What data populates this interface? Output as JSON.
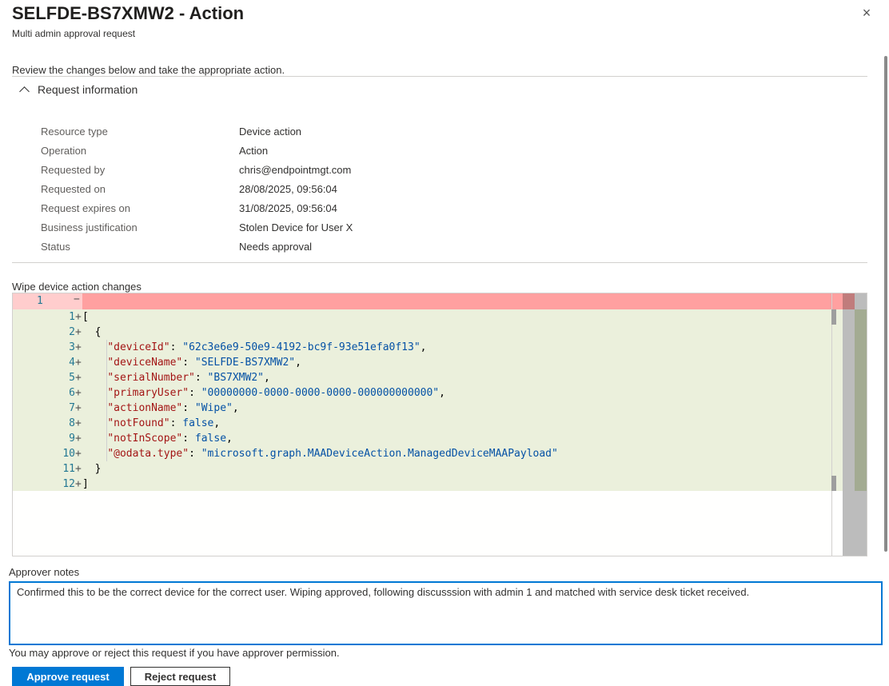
{
  "header": {
    "title": "SELFDE-BS7XMW2 - Action",
    "subtitle": "Multi admin approval request",
    "close_icon": "×"
  },
  "intro": "Review the changes below and take the appropriate action.",
  "request_info": {
    "section_label": "Request information",
    "rows": [
      {
        "label": "Resource type",
        "value": "Device action"
      },
      {
        "label": "Operation",
        "value": "Action"
      },
      {
        "label": "Requested by",
        "value": "chris@endpointmgt.com"
      },
      {
        "label": "Requested on",
        "value": "28/08/2025, 09:56:04"
      },
      {
        "label": "Request expires on",
        "value": "31/08/2025, 09:56:04"
      },
      {
        "label": "Business justification",
        "value": "Stolen Device for User X"
      },
      {
        "label": "Status",
        "value": "Needs approval"
      }
    ]
  },
  "diff": {
    "label": "Wipe device action changes",
    "removed_line": {
      "number": "1",
      "marker": "−"
    },
    "added_marker": "+",
    "lines": [
      {
        "n": "1",
        "parts": [
          [
            "p",
            "["
          ]
        ]
      },
      {
        "n": "2",
        "parts": [
          [
            "p",
            "  {"
          ]
        ]
      },
      {
        "n": "3",
        "parts": [
          [
            "p",
            "    "
          ],
          [
            "k",
            "\"deviceId\""
          ],
          [
            "p",
            ": "
          ],
          [
            "s",
            "\"62c3e6e9-50e9-4192-bc9f-93e51efa0f13\""
          ],
          [
            "p",
            ","
          ]
        ]
      },
      {
        "n": "4",
        "parts": [
          [
            "p",
            "    "
          ],
          [
            "k",
            "\"deviceName\""
          ],
          [
            "p",
            ": "
          ],
          [
            "s",
            "\"SELFDE-BS7XMW2\""
          ],
          [
            "p",
            ","
          ]
        ]
      },
      {
        "n": "5",
        "parts": [
          [
            "p",
            "    "
          ],
          [
            "k",
            "\"serialNumber\""
          ],
          [
            "p",
            ": "
          ],
          [
            "s",
            "\"BS7XMW2\""
          ],
          [
            "p",
            ","
          ]
        ]
      },
      {
        "n": "6",
        "parts": [
          [
            "p",
            "    "
          ],
          [
            "k",
            "\"primaryUser\""
          ],
          [
            "p",
            ": "
          ],
          [
            "s",
            "\"00000000-0000-0000-0000-000000000000\""
          ],
          [
            "p",
            ","
          ]
        ]
      },
      {
        "n": "7",
        "parts": [
          [
            "p",
            "    "
          ],
          [
            "k",
            "\"actionName\""
          ],
          [
            "p",
            ": "
          ],
          [
            "s",
            "\"Wipe\""
          ],
          [
            "p",
            ","
          ]
        ]
      },
      {
        "n": "8",
        "parts": [
          [
            "p",
            "    "
          ],
          [
            "k",
            "\"notFound\""
          ],
          [
            "p",
            ": "
          ],
          [
            "s",
            "false"
          ],
          [
            "p",
            ","
          ]
        ]
      },
      {
        "n": "9",
        "parts": [
          [
            "p",
            "    "
          ],
          [
            "k",
            "\"notInScope\""
          ],
          [
            "p",
            ": "
          ],
          [
            "s",
            "false"
          ],
          [
            "p",
            ","
          ]
        ]
      },
      {
        "n": "10",
        "parts": [
          [
            "p",
            "    "
          ],
          [
            "k",
            "\"@odata.type\""
          ],
          [
            "p",
            ": "
          ],
          [
            "s",
            "\"microsoft.graph.MAADeviceAction.ManagedDeviceMAAPayload\""
          ]
        ]
      },
      {
        "n": "11",
        "parts": [
          [
            "p",
            "  }"
          ]
        ]
      },
      {
        "n": "12",
        "parts": [
          [
            "p",
            "]"
          ]
        ]
      }
    ],
    "colors": {
      "removed": "#ffa0a0",
      "added": "#ebf0dc",
      "key": "#a31515",
      "string": "#0451a5"
    }
  },
  "approver": {
    "label": "Approver notes",
    "notes": "Confirmed this to be the correct device for the correct user. Wiping approved, following discusssion with admin 1 and matched with service desk ticket received.",
    "permission_text": "You may approve or reject this request if you have approver permission.",
    "approve_label": "Approve request",
    "reject_label": "Reject request"
  },
  "colors": {
    "accent": "#0078d4"
  }
}
